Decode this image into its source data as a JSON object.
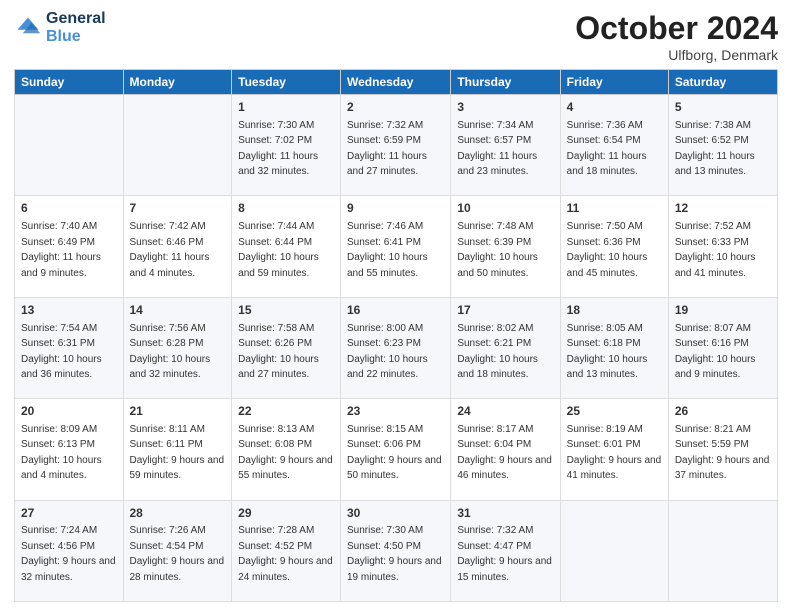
{
  "header": {
    "logo_line1": "General",
    "logo_line2": "Blue",
    "month_title": "October 2024",
    "location": "Ulfborg, Denmark"
  },
  "days_of_week": [
    "Sunday",
    "Monday",
    "Tuesday",
    "Wednesday",
    "Thursday",
    "Friday",
    "Saturday"
  ],
  "weeks": [
    [
      {
        "day": "",
        "sunrise": "",
        "sunset": "",
        "daylight": ""
      },
      {
        "day": "",
        "sunrise": "",
        "sunset": "",
        "daylight": ""
      },
      {
        "day": "1",
        "sunrise": "Sunrise: 7:30 AM",
        "sunset": "Sunset: 7:02 PM",
        "daylight": "Daylight: 11 hours and 32 minutes."
      },
      {
        "day": "2",
        "sunrise": "Sunrise: 7:32 AM",
        "sunset": "Sunset: 6:59 PM",
        "daylight": "Daylight: 11 hours and 27 minutes."
      },
      {
        "day": "3",
        "sunrise": "Sunrise: 7:34 AM",
        "sunset": "Sunset: 6:57 PM",
        "daylight": "Daylight: 11 hours and 23 minutes."
      },
      {
        "day": "4",
        "sunrise": "Sunrise: 7:36 AM",
        "sunset": "Sunset: 6:54 PM",
        "daylight": "Daylight: 11 hours and 18 minutes."
      },
      {
        "day": "5",
        "sunrise": "Sunrise: 7:38 AM",
        "sunset": "Sunset: 6:52 PM",
        "daylight": "Daylight: 11 hours and 13 minutes."
      }
    ],
    [
      {
        "day": "6",
        "sunrise": "Sunrise: 7:40 AM",
        "sunset": "Sunset: 6:49 PM",
        "daylight": "Daylight: 11 hours and 9 minutes."
      },
      {
        "day": "7",
        "sunrise": "Sunrise: 7:42 AM",
        "sunset": "Sunset: 6:46 PM",
        "daylight": "Daylight: 11 hours and 4 minutes."
      },
      {
        "day": "8",
        "sunrise": "Sunrise: 7:44 AM",
        "sunset": "Sunset: 6:44 PM",
        "daylight": "Daylight: 10 hours and 59 minutes."
      },
      {
        "day": "9",
        "sunrise": "Sunrise: 7:46 AM",
        "sunset": "Sunset: 6:41 PM",
        "daylight": "Daylight: 10 hours and 55 minutes."
      },
      {
        "day": "10",
        "sunrise": "Sunrise: 7:48 AM",
        "sunset": "Sunset: 6:39 PM",
        "daylight": "Daylight: 10 hours and 50 minutes."
      },
      {
        "day": "11",
        "sunrise": "Sunrise: 7:50 AM",
        "sunset": "Sunset: 6:36 PM",
        "daylight": "Daylight: 10 hours and 45 minutes."
      },
      {
        "day": "12",
        "sunrise": "Sunrise: 7:52 AM",
        "sunset": "Sunset: 6:33 PM",
        "daylight": "Daylight: 10 hours and 41 minutes."
      }
    ],
    [
      {
        "day": "13",
        "sunrise": "Sunrise: 7:54 AM",
        "sunset": "Sunset: 6:31 PM",
        "daylight": "Daylight: 10 hours and 36 minutes."
      },
      {
        "day": "14",
        "sunrise": "Sunrise: 7:56 AM",
        "sunset": "Sunset: 6:28 PM",
        "daylight": "Daylight: 10 hours and 32 minutes."
      },
      {
        "day": "15",
        "sunrise": "Sunrise: 7:58 AM",
        "sunset": "Sunset: 6:26 PM",
        "daylight": "Daylight: 10 hours and 27 minutes."
      },
      {
        "day": "16",
        "sunrise": "Sunrise: 8:00 AM",
        "sunset": "Sunset: 6:23 PM",
        "daylight": "Daylight: 10 hours and 22 minutes."
      },
      {
        "day": "17",
        "sunrise": "Sunrise: 8:02 AM",
        "sunset": "Sunset: 6:21 PM",
        "daylight": "Daylight: 10 hours and 18 minutes."
      },
      {
        "day": "18",
        "sunrise": "Sunrise: 8:05 AM",
        "sunset": "Sunset: 6:18 PM",
        "daylight": "Daylight: 10 hours and 13 minutes."
      },
      {
        "day": "19",
        "sunrise": "Sunrise: 8:07 AM",
        "sunset": "Sunset: 6:16 PM",
        "daylight": "Daylight: 10 hours and 9 minutes."
      }
    ],
    [
      {
        "day": "20",
        "sunrise": "Sunrise: 8:09 AM",
        "sunset": "Sunset: 6:13 PM",
        "daylight": "Daylight: 10 hours and 4 minutes."
      },
      {
        "day": "21",
        "sunrise": "Sunrise: 8:11 AM",
        "sunset": "Sunset: 6:11 PM",
        "daylight": "Daylight: 9 hours and 59 minutes."
      },
      {
        "day": "22",
        "sunrise": "Sunrise: 8:13 AM",
        "sunset": "Sunset: 6:08 PM",
        "daylight": "Daylight: 9 hours and 55 minutes."
      },
      {
        "day": "23",
        "sunrise": "Sunrise: 8:15 AM",
        "sunset": "Sunset: 6:06 PM",
        "daylight": "Daylight: 9 hours and 50 minutes."
      },
      {
        "day": "24",
        "sunrise": "Sunrise: 8:17 AM",
        "sunset": "Sunset: 6:04 PM",
        "daylight": "Daylight: 9 hours and 46 minutes."
      },
      {
        "day": "25",
        "sunrise": "Sunrise: 8:19 AM",
        "sunset": "Sunset: 6:01 PM",
        "daylight": "Daylight: 9 hours and 41 minutes."
      },
      {
        "day": "26",
        "sunrise": "Sunrise: 8:21 AM",
        "sunset": "Sunset: 5:59 PM",
        "daylight": "Daylight: 9 hours and 37 minutes."
      }
    ],
    [
      {
        "day": "27",
        "sunrise": "Sunrise: 7:24 AM",
        "sunset": "Sunset: 4:56 PM",
        "daylight": "Daylight: 9 hours and 32 minutes."
      },
      {
        "day": "28",
        "sunrise": "Sunrise: 7:26 AM",
        "sunset": "Sunset: 4:54 PM",
        "daylight": "Daylight: 9 hours and 28 minutes."
      },
      {
        "day": "29",
        "sunrise": "Sunrise: 7:28 AM",
        "sunset": "Sunset: 4:52 PM",
        "daylight": "Daylight: 9 hours and 24 minutes."
      },
      {
        "day": "30",
        "sunrise": "Sunrise: 7:30 AM",
        "sunset": "Sunset: 4:50 PM",
        "daylight": "Daylight: 9 hours and 19 minutes."
      },
      {
        "day": "31",
        "sunrise": "Sunrise: 7:32 AM",
        "sunset": "Sunset: 4:47 PM",
        "daylight": "Daylight: 9 hours and 15 minutes."
      },
      {
        "day": "",
        "sunrise": "",
        "sunset": "",
        "daylight": ""
      },
      {
        "day": "",
        "sunrise": "",
        "sunset": "",
        "daylight": ""
      }
    ]
  ]
}
